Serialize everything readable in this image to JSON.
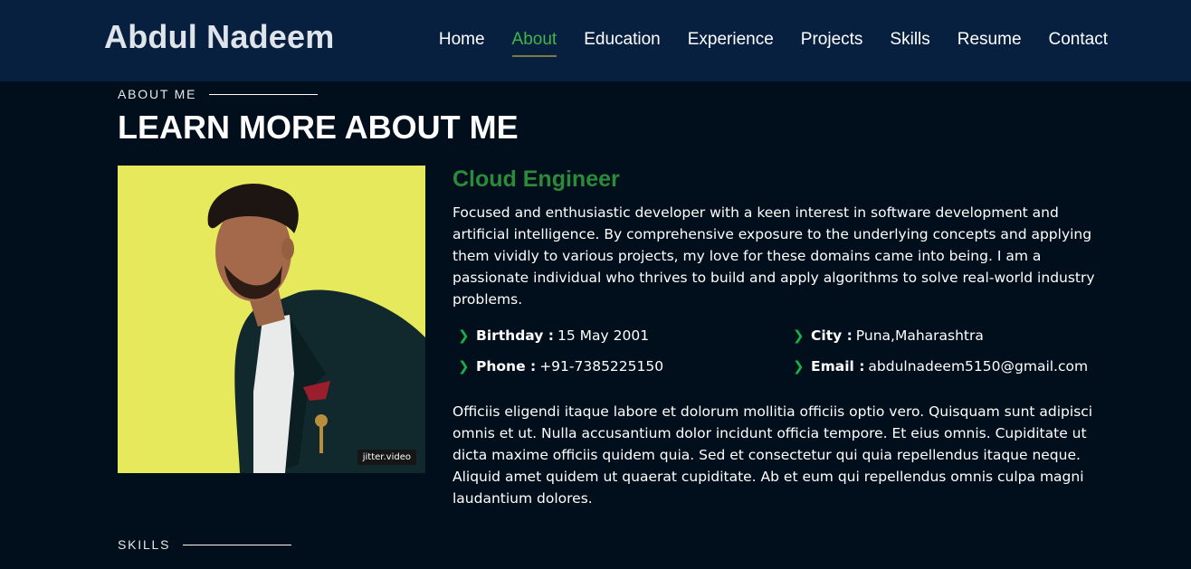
{
  "header": {
    "logo": "Abdul Nadeem",
    "nav": [
      {
        "label": "Home",
        "active": false
      },
      {
        "label": "About",
        "active": true
      },
      {
        "label": "Education",
        "active": false
      },
      {
        "label": "Experience",
        "active": false
      },
      {
        "label": "Projects",
        "active": false
      },
      {
        "label": "Skills",
        "active": false
      },
      {
        "label": "Resume",
        "active": false
      },
      {
        "label": "Contact",
        "active": false
      }
    ]
  },
  "about": {
    "label": "ABOUT ME",
    "heading": "LEARN MORE ABOUT ME",
    "photo_tag": "jitter.video",
    "role": "Cloud Engineer",
    "intro": "Focused and enthusiastic developer with a keen interest in software development and artificial intelligence. By comprehensive exposure to the underlying concepts and applying them vividly to various projects, my love for these domains came into being. I am a passionate individual who thrives to build and apply algorithms to solve real-world industry problems.",
    "details": [
      {
        "key": "Birthday :",
        "value": "15 May 2001"
      },
      {
        "key": "City :",
        "value": "Puna,Maharashtra"
      },
      {
        "key": "Phone :",
        "value": "+91-7385225150"
      },
      {
        "key": "Email :",
        "value": "abdulnadeem5150@gmail.com"
      }
    ],
    "lorem": "Officiis eligendi itaque labore et dolorum mollitia officiis optio vero. Quisquam sunt adipisci omnis et ut. Nulla accusantium dolor incidunt officia tempore. Et eius omnis. Cupiditate ut dicta maxime officiis quidem quia. Sed et consectetur qui quia repellendus itaque neque. Aliquid amet quidem ut quaerat cupiditate. Ab et eum qui repellendus omnis culpa magni laudantium dolores."
  },
  "skills": {
    "label": "SKILLS"
  },
  "colors": {
    "header_bg": "#08203f",
    "page_bg": "#010e1b",
    "accent_green": "#3fb54a",
    "role_green": "#2c8a3b",
    "photo_bg": "#e6e95b"
  }
}
